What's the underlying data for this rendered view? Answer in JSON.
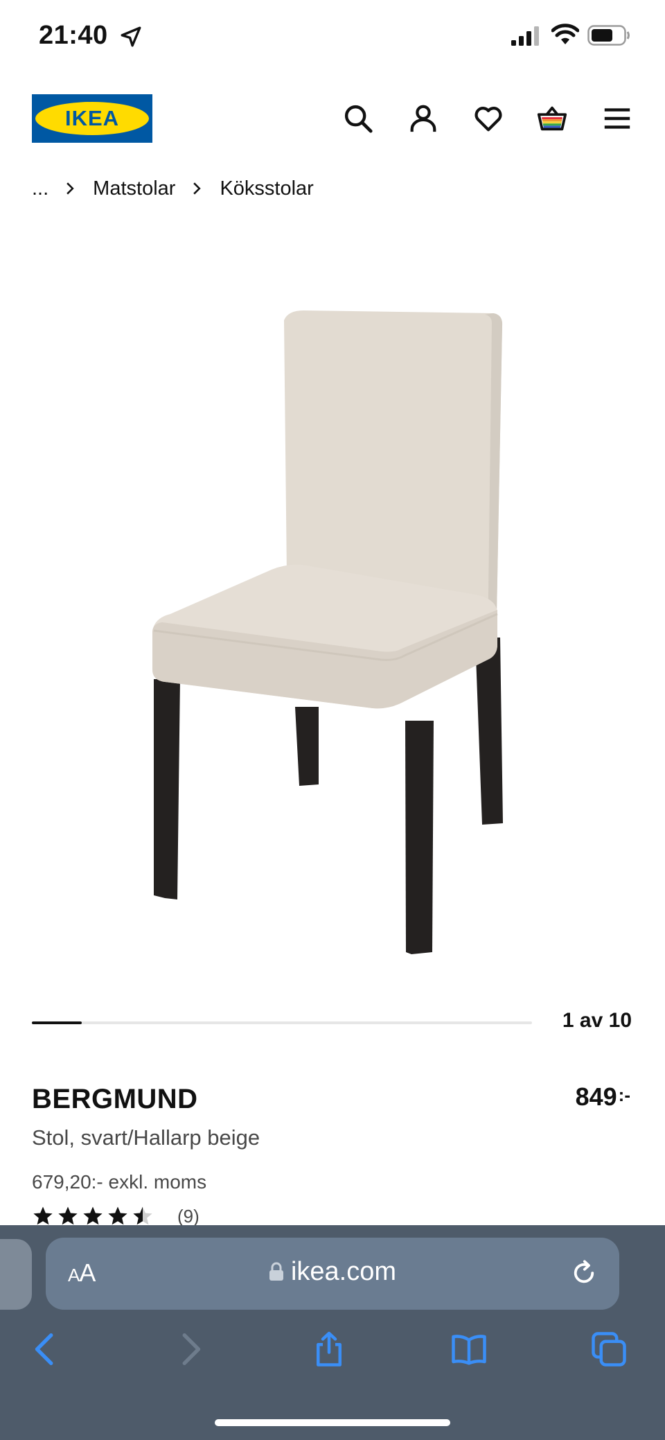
{
  "status_bar": {
    "time": "21:40",
    "icons": [
      "location-arrow-icon",
      "cellular-signal-icon",
      "wifi-icon",
      "battery-icon"
    ]
  },
  "header": {
    "logo_text": "IKEA",
    "brand_colors": {
      "blue": "#0058a3",
      "yellow": "#ffdb00"
    },
    "icons": [
      "search-icon",
      "profile-icon",
      "heart-icon",
      "shopping-bag-icon",
      "hamburger-menu-icon"
    ]
  },
  "breadcrumb": {
    "items": [
      "...",
      "Matstolar",
      "Köksstolar"
    ]
  },
  "product_image": {
    "icon": "chair-product-image",
    "seat_color": "#e3dcd2",
    "leg_color": "#242120"
  },
  "carousel": {
    "current": 1,
    "total": 10,
    "counter_text": "1 av 10",
    "progress": 0.1
  },
  "product": {
    "name": "BERGMUND",
    "price": "849",
    "price_suffix": ":-",
    "description": "Stol, svart/Hallarp beige",
    "price_ex_vat": "679,20:- exkl. moms",
    "rating_value": 4.5,
    "rating_count": "(9)"
  },
  "browser": {
    "text_size_label_small": "A",
    "text_size_label_large": "A",
    "url": "ikea.com",
    "background_color": "#4e5b6a",
    "toolbar_icons": [
      "back-icon",
      "forward-icon",
      "share-icon",
      "bookmarks-icon",
      "tabs-icon"
    ]
  }
}
